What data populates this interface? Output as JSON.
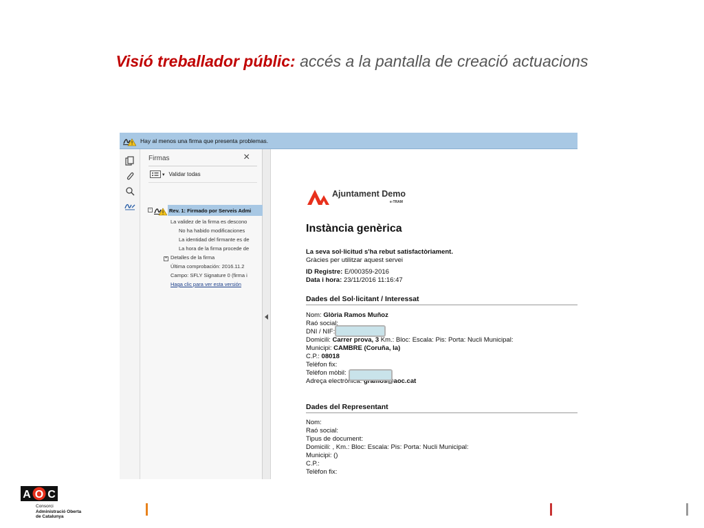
{
  "slide": {
    "title_lead": "Visió treballador públic:",
    "title_rest": " accés a la pantalla de creació actuacions"
  },
  "banner": {
    "message": "Hay al menos una firma que presenta problemas."
  },
  "panel": {
    "title": "Firmas",
    "validate_label": "Validar todas",
    "signature_label": "Rev. 1: Firmado por Serveis Admi",
    "details": [
      "La validez de la firma es descono",
      "No ha habido modificaciones",
      "La identidad del firmante es de",
      "La hora de la firma procede de"
    ],
    "details_toggle": "Detalles de la firma",
    "last_check": "Última comprobación: 2016.11.2",
    "field": "Campo: SFLY Signature 0 (firma i",
    "view_version_link": "Haga clic para ver esta versión"
  },
  "document": {
    "org_name": "Ajuntament Demo",
    "org_sub": "e-TRAM",
    "title": "Instància genèrica",
    "received": "La seva sol·licitud s'ha rebut satisfactòriament.",
    "thanks": "Gràcies per utilitzar aquest servei",
    "id_label": "ID Registre:",
    "id_value": "E/000359-2016",
    "date_label": "Data i hora:",
    "date_value": "23/11/2016 11:16:47",
    "applicant": {
      "heading": "Dades del Sol·licitant / Interessat",
      "name_label": "Nom:",
      "name_value": "Glòria Ramos Muñoz",
      "company_label": "Raó social:",
      "dni_label": "DNI / NIF:",
      "address_label": "Domicili:",
      "address_value": "Carrer prova, 3",
      "address_rest": " Km.:  Bloc:  Escala:  Pis:  Porta:  Nucli Municipal:",
      "city_label": "Municipi:",
      "city_value": "CAMBRE (Coruña, la)",
      "cp_label": "C.P.:",
      "cp_value": "08018",
      "phone_label": "Telèfon fix:",
      "mobile_label": "Telèfon mòbil:",
      "email_label": "Adreça electrònica:",
      "email_value": "gramos@aoc.cat"
    },
    "representative": {
      "heading": "Dades del Representant",
      "name_label": "Nom:",
      "company_label": "Raó social:",
      "doc_type_label": "Tipus de document:",
      "address_line": "Domicili:  ,   Km.:  Bloc: Escala: Pis:  Porta:  Nucli Municipal:",
      "city_line": "Municipi: ()",
      "cp_label": "C.P.:",
      "phone_label": "Telèfon fix:"
    }
  },
  "footer": {
    "logo_text": "AOC",
    "caption_line1": "Consorci",
    "caption_line2": "Administració Oberta",
    "caption_line3": "de Catalunya"
  },
  "colors": {
    "title_accent": "#c00000",
    "banner": "#a8c8e4",
    "selection": "#a8c8e4",
    "logo_red": "#e8301c",
    "redaction": "#c9e3ea",
    "marker_orange": "#e8821c",
    "marker_red": "#c83232",
    "marker_grey": "#9a9a9a"
  }
}
